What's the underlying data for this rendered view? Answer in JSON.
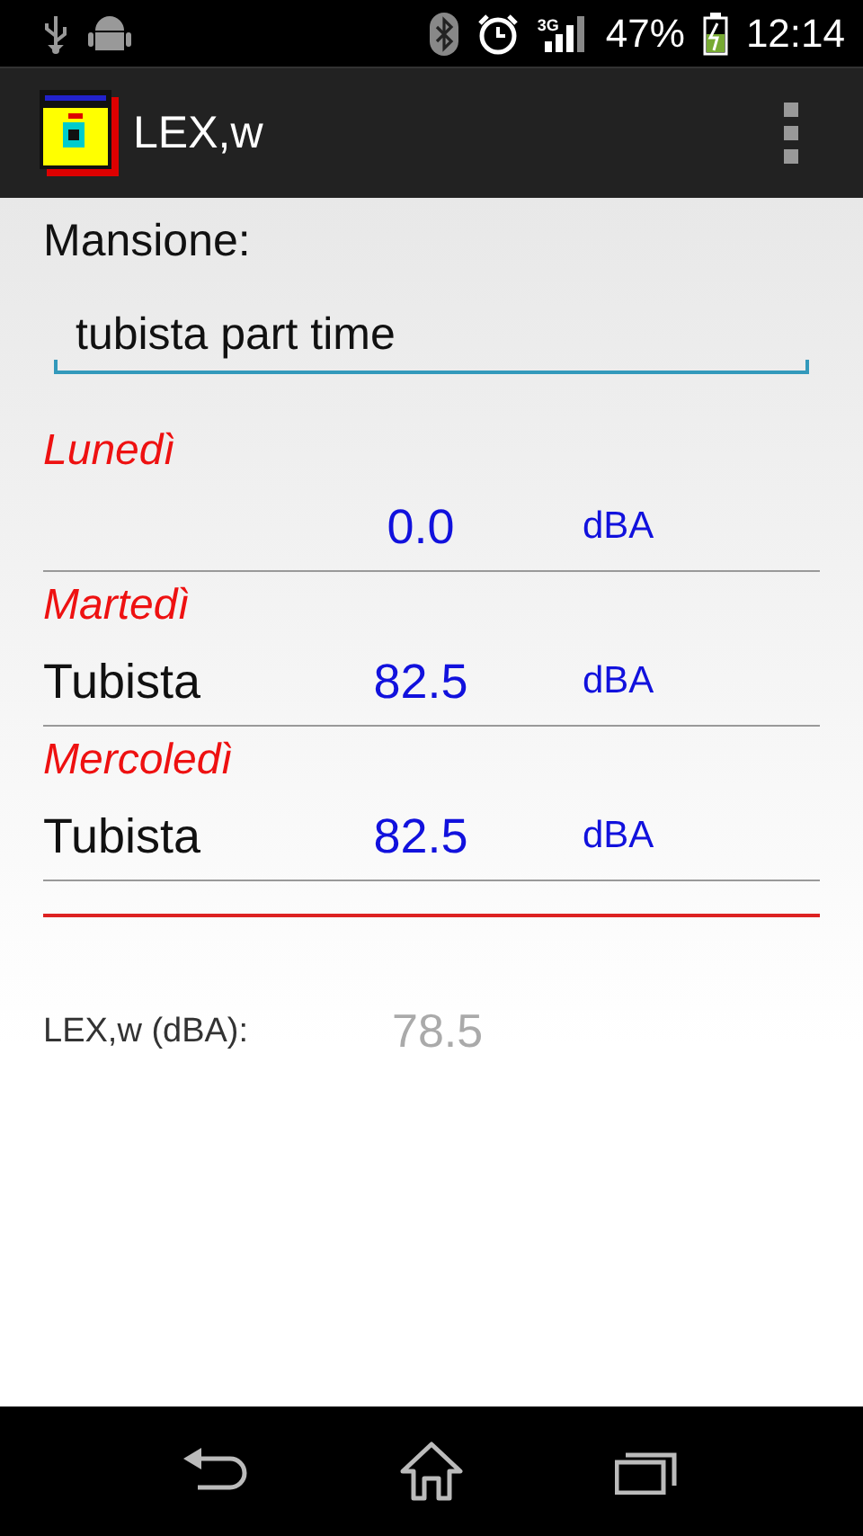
{
  "status_bar": {
    "network": "3G",
    "battery": "47%",
    "time": "12:14"
  },
  "app_bar": {
    "title": "LEX,w"
  },
  "job": {
    "label": "Mansione:",
    "value": "tubista part time"
  },
  "days": [
    {
      "day": "Lunedì",
      "value": "0.0",
      "unit": "dBA"
    },
    {
      "day": "Martedì",
      "activity": "Tubista",
      "value": "82.5",
      "unit": "dBA"
    },
    {
      "day": "Mercoledì",
      "activity": "Tubista",
      "value": "82.5",
      "unit": "dBA"
    }
  ],
  "result": {
    "label": "LEX,w (dBA):",
    "value": "78.5"
  }
}
